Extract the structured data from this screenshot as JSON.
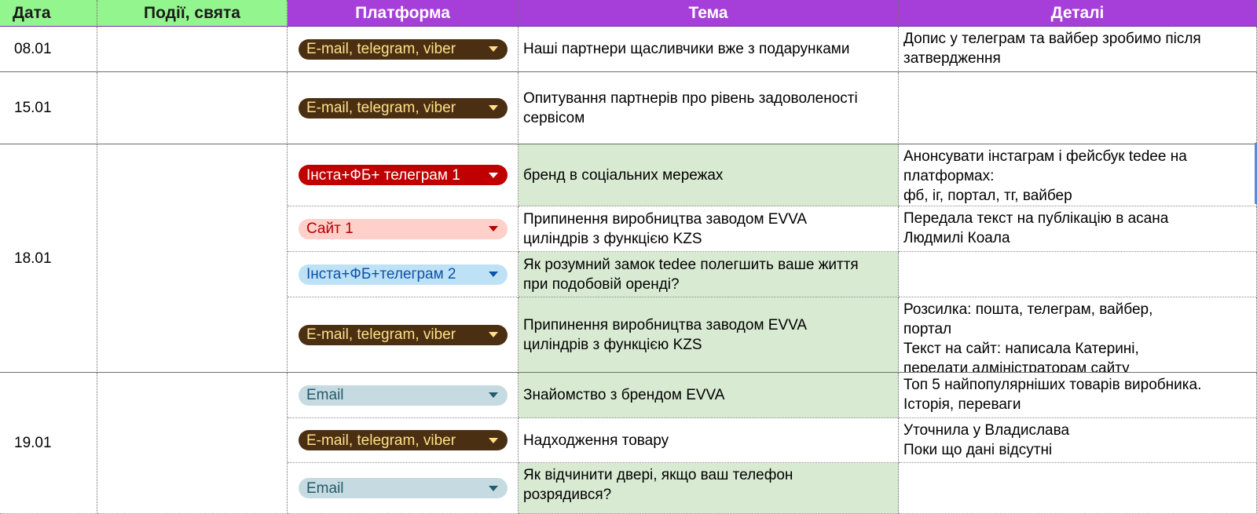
{
  "headers": {
    "date": "Дата",
    "events": "Події, свята",
    "platform": "Платформа",
    "theme": "Тема",
    "details": "Деталі"
  },
  "colors": {
    "header_purple": "#a63fd9",
    "header_green": "#93f58d",
    "theme_green": "#d9ead3"
  },
  "rows": [
    {
      "date": "08.01",
      "platform": "E-mail, telegram, viber",
      "theme": "Наші партнери щасливчики вже з подарунками",
      "details": [
        "Допис у телеграм та вайбер зробимо після",
        "затвердження"
      ]
    },
    {
      "date": "15.01",
      "platform": "E-mail, telegram, viber",
      "theme": [
        "Опитування партнерів про рівень задоволеності",
        "сервісом"
      ],
      "details": []
    },
    {
      "date": "18.01",
      "platform": "Інста+ФБ+ телеграм 1",
      "theme": "бренд в соціальних мережах",
      "details": [
        "Анонсувати інстаграм і фейсбук tedee на",
        "платформах:",
        "фб, іг, портал, тг, вайбер"
      ]
    },
    {
      "platform": "Сайт 1",
      "theme": [
        "Припинення виробництва заводом EVVA",
        "циліндрів з функцією KZS"
      ],
      "details": [
        "Передала текст на публікацію в асана",
        "Людмилі Коала"
      ]
    },
    {
      "platform": "Інста+ФБ+телеграм 2",
      "theme": [
        "Як розумний замок tedee полегшить ваше життя",
        "при подобовій оренді?"
      ],
      "details": []
    },
    {
      "platform": "E-mail, telegram, viber",
      "theme": [
        "Припинення виробництва заводом EVVA",
        "циліндрів з функцією KZS"
      ],
      "details": [
        "Розсилка: пошта, телеграм, вайбер,",
        "портал",
        "Текст на сайт: написала Катерині,",
        "передати адміністраторам сайту"
      ]
    },
    {
      "date": "19.01",
      "platform": "Email",
      "theme": "Знайомство з брендом EVVA",
      "details": [
        "Топ 5 найпопулярніших товарів виробника.",
        "Історія, переваги"
      ]
    },
    {
      "platform": "E-mail, telegram, viber",
      "theme": "Надходження товару",
      "details": [
        "Уточнила у Владислава",
        "Поки що дані відсутні"
      ]
    },
    {
      "platform": "Email",
      "theme": [
        "Як відчинити двері, якщо ваш телефон",
        "розрядився?"
      ],
      "details": []
    }
  ]
}
